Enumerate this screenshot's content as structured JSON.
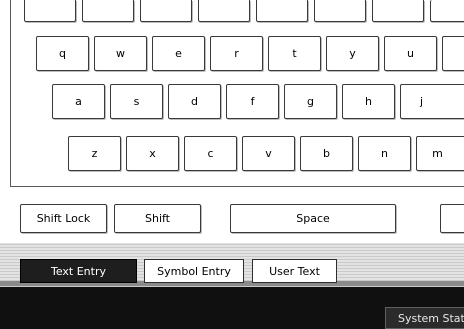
{
  "keyboard": {
    "row_top_partial": [
      "",
      "",
      "",
      "",
      "",
      "",
      "",
      ""
    ],
    "row1": [
      "q",
      "w",
      "e",
      "r",
      "t",
      "y",
      "u"
    ],
    "row2": [
      "a",
      "s",
      "d",
      "f",
      "g",
      "h",
      "j"
    ],
    "row3": [
      "z",
      "x",
      "c",
      "v",
      "b",
      "n",
      "m"
    ],
    "bottom": {
      "shift_lock": "Shift Lock",
      "shift": "Shift",
      "space": "Space"
    }
  },
  "tabs": [
    {
      "label": "Text Entry",
      "active": true
    },
    {
      "label": "Symbol Entry",
      "active": false
    },
    {
      "label": "User Text",
      "active": false
    }
  ],
  "status_bar": {
    "system_status_label": "System Statu"
  }
}
